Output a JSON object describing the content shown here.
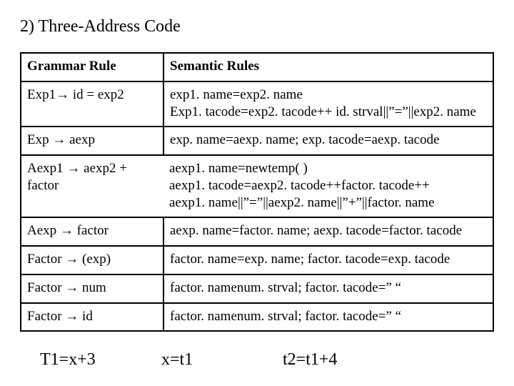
{
  "title": "2) Three-Address Code",
  "header": {
    "grammar": "Grammar Rule",
    "semantic": "Semantic Rules"
  },
  "rows": [
    {
      "grammar": " Exp1→ id = exp2",
      "semantic": "exp1. name=exp2. name\nExp1. tacode=exp2. tacode++ id. strval||”=”||exp2. name"
    },
    {
      "grammar": "Exp → aexp",
      "semantic": "exp. name=aexp. name; exp. tacode=aexp. tacode"
    },
    {
      "grammar": "Aexp1 → aexp2 + factor",
      "semantic": "aexp1. name=newtemp( )\naexp1. tacode=aexp2. tacode++factor. tacode++\naexp1. name||”=”||aexp2. name||”+”||factor. name"
    },
    {
      "grammar": "Aexp → factor",
      "semantic": "aexp. name=factor. name; aexp. tacode=factor. tacode"
    },
    {
      "grammar": "Factor → (exp)",
      "semantic": "factor. name=exp. name; factor. tacode=exp. tacode"
    },
    {
      "grammar": "Factor → num",
      "semantic": "factor. namenum. strval; factor. tacode=” “"
    },
    {
      "grammar": "Factor →  id",
      "semantic": "factor. namenum. strval; factor. tacode=” “"
    }
  ],
  "footer": {
    "a": "T1=x+3",
    "b": "x=t1",
    "c": "t2=t1+4"
  }
}
